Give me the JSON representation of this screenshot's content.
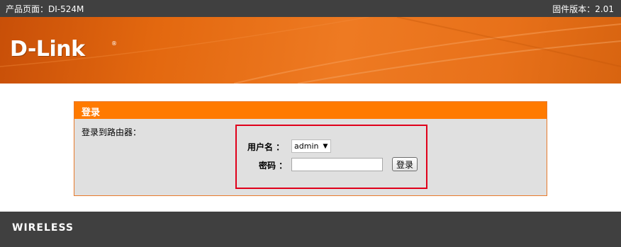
{
  "header": {
    "product_page": "产品页面：DI-524M",
    "firmware": "固件版本：2.01"
  },
  "banner": {
    "brand": "D-Link",
    "registered": "®"
  },
  "login_panel": {
    "title": "登录",
    "description": "登录到路由器："
  },
  "form": {
    "username_label": "用户名 ：",
    "username_value": "admin",
    "username_options": [
      "admin"
    ],
    "password_label": "密码 ：",
    "password_value": "",
    "submit_label": "登录"
  },
  "footer": {
    "label": "WIRELESS"
  },
  "colors": {
    "topbar": "#404040",
    "banner_orange": "#e3680f",
    "panel_header": "#ff7a00",
    "panel_body": "#e0e0e0",
    "highlight_box": "#e0001a"
  }
}
